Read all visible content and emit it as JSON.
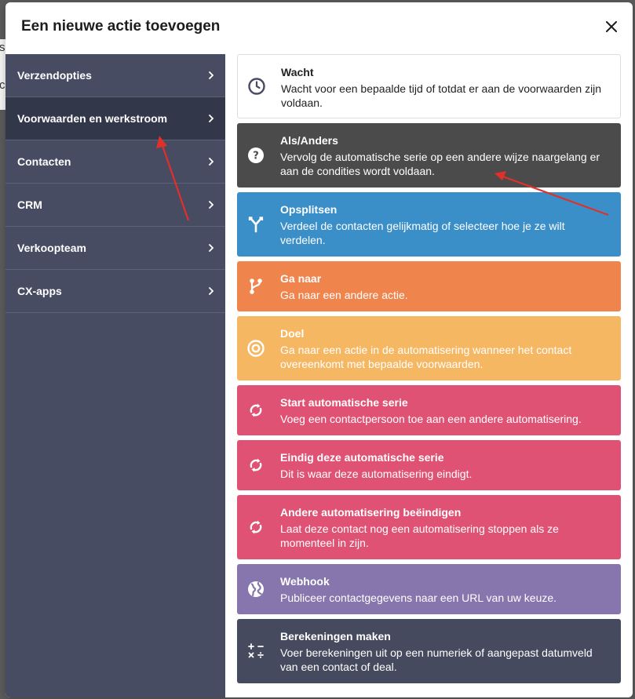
{
  "modal": {
    "title": "Een nieuwe actie toevoegen"
  },
  "background": {
    "peek_1": "s",
    "peek_2": "c"
  },
  "sidebar": {
    "items": [
      {
        "label": "Verzendopties",
        "active": false
      },
      {
        "label": "Voorwaarden en werkstroom",
        "active": true
      },
      {
        "label": "Contacten",
        "active": false
      },
      {
        "label": "CRM",
        "active": false
      },
      {
        "label": "Verkoopteam",
        "active": false
      },
      {
        "label": "CX-apps",
        "active": false
      }
    ]
  },
  "actions": [
    {
      "title": "Wacht",
      "desc": "Wacht voor een bepaalde tijd of totdat er aan de voorwaarden zijn voldaan.",
      "icon": "clock-icon",
      "color": "#ffffff"
    },
    {
      "title": "Als/Anders",
      "desc": "Vervolg de automatische serie op een andere wijze naargelang er aan de condities wordt voldaan.",
      "icon": "question-icon",
      "color": "#4b4b4b"
    },
    {
      "title": "Opsplitsen",
      "desc": "Verdeel de contacten gelijkmatig of selecteer hoe je ze wilt verdelen.",
      "icon": "split-icon",
      "color": "#3b8fc8"
    },
    {
      "title": "Ga naar",
      "desc": "Ga naar een andere actie.",
      "icon": "branch-icon",
      "color": "#ef844d"
    },
    {
      "title": "Doel",
      "desc": "Ga naar een actie in de automatisering wanneer het contact overeenkomt met bepaalde voorwaarden.",
      "icon": "target-icon",
      "color": "#f6b763"
    },
    {
      "title": "Start automatische serie",
      "desc": "Voeg een contactpersoon toe aan een andere automatisering.",
      "icon": "sync-icon",
      "color": "#df5274"
    },
    {
      "title": "Eindig deze automatische serie",
      "desc": "Dit is waar deze automatisering eindigt.",
      "icon": "sync-icon",
      "color": "#df5274"
    },
    {
      "title": "Andere automatisering beëindigen",
      "desc": "Laat deze contact nog een automatisering stoppen als ze momenteel in zijn.",
      "icon": "sync-icon",
      "color": "#df5274"
    },
    {
      "title": "Webhook",
      "desc": "Publiceer contactgegevens naar een URL van uw keuze.",
      "icon": "globe-icon",
      "color": "#8775ad"
    },
    {
      "title": "Berekeningen maken",
      "desc": "Voer berekeningen uit op een numeriek of aangepast datumveld van een contact of deal.",
      "icon": "calculator-icon",
      "color": "#464a5e"
    }
  ],
  "annotation_color": "#e0302a"
}
